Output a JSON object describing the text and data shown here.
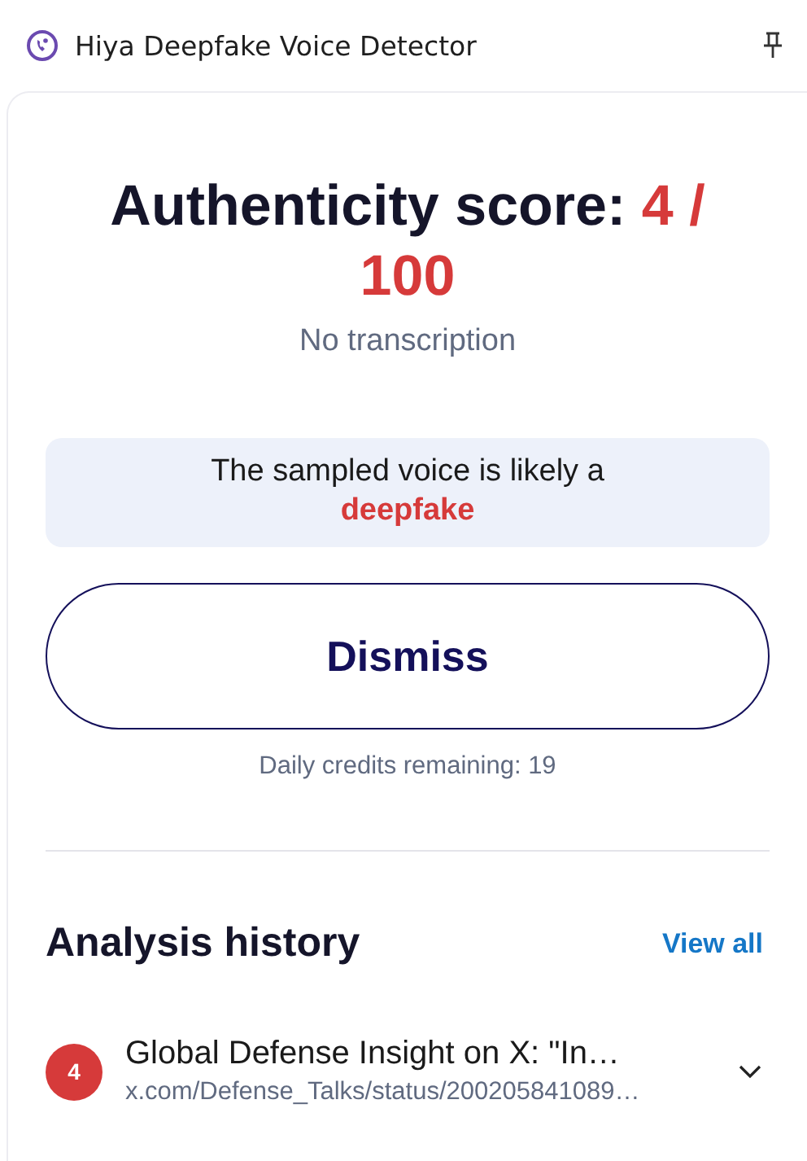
{
  "window": {
    "title": "Hiya Deepfake Voice Detector"
  },
  "result": {
    "label": "Authenticity score:",
    "score": "4 / 100",
    "transcription": "No transcription",
    "verdict": "The sampled voice is likely a **deepfake**",
    "dismiss": "Dismiss",
    "credits": "Daily credits remaining: 19"
  },
  "history": {
    "title": "Analysis history",
    "view_all": "View all",
    "items": [
      {
        "score": "4",
        "color": "#d63a3a",
        "title": "Global Defense Insight on X: \"In…",
        "url": "x.com/Defense_Talks/status/200205841089…",
        "expanded": false
      }
    ]
  }
}
